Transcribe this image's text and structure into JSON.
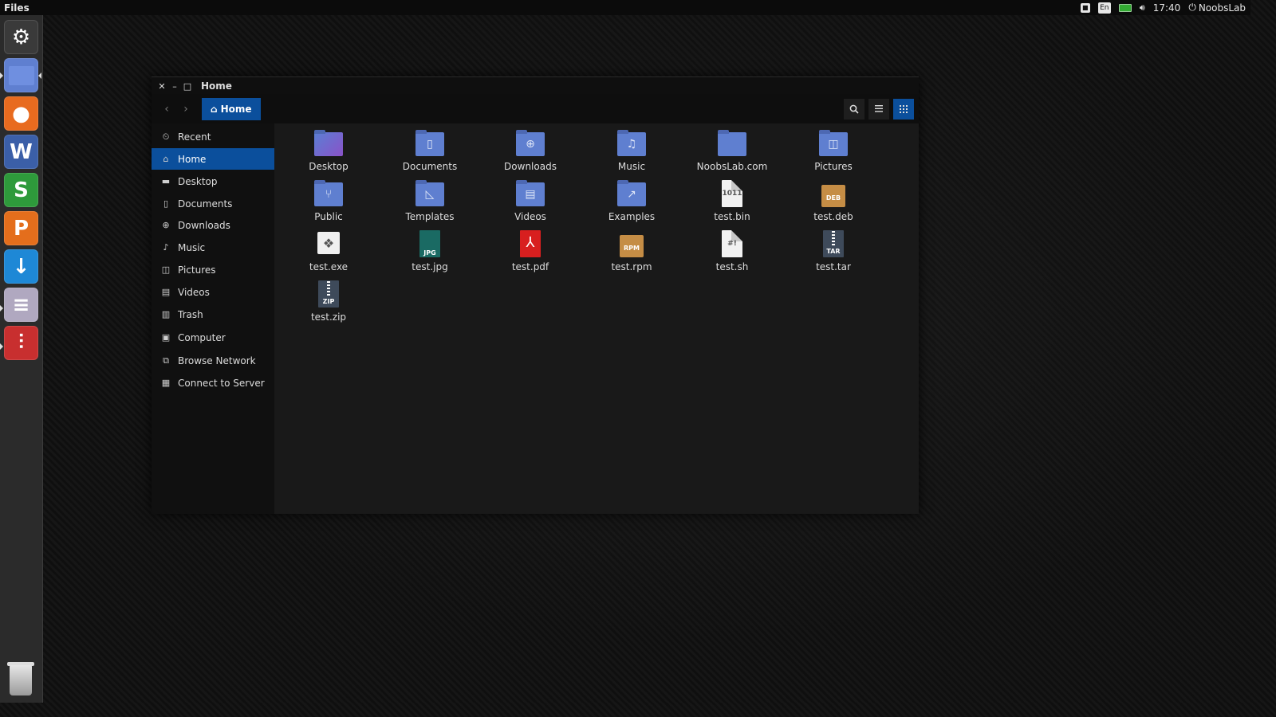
{
  "top_panel": {
    "app_name": "Files",
    "language": "En",
    "time": "17:40",
    "user": "NoobsLab"
  },
  "launcher": {
    "items": [
      {
        "name": "dash",
        "glyph": "⚙",
        "color": "#3a3a3a"
      },
      {
        "name": "files",
        "glyph": "",
        "color": "#5f7fd0"
      },
      {
        "name": "firefox",
        "glyph": "●",
        "color": "#e86b1f"
      },
      {
        "name": "writer",
        "glyph": "W",
        "color": "#3b5fa8"
      },
      {
        "name": "spreadsheet",
        "glyph": "S",
        "color": "#2e9a3b"
      },
      {
        "name": "presentation",
        "glyph": "P",
        "color": "#e46e1c"
      },
      {
        "name": "downloader",
        "glyph": "↓",
        "color": "#1e88d6"
      },
      {
        "name": "settings",
        "glyph": "≡",
        "color": "#b0a8c0"
      },
      {
        "name": "mixer",
        "glyph": "⫶",
        "color": "#c82f2f"
      }
    ]
  },
  "window": {
    "title": "Home",
    "path_label": "Home",
    "accent": "#0b4f9c"
  },
  "sidebar": {
    "items": [
      {
        "label": "Recent",
        "icon": "⏲",
        "selected": false
      },
      {
        "label": "Home",
        "icon": "⌂",
        "selected": true
      },
      {
        "label": "Desktop",
        "icon": "▬",
        "selected": false
      },
      {
        "label": "Documents",
        "icon": "▯",
        "selected": false
      },
      {
        "label": "Downloads",
        "icon": "⊕",
        "selected": false
      },
      {
        "label": "Music",
        "icon": "♪",
        "selected": false
      },
      {
        "label": "Pictures",
        "icon": "◫",
        "selected": false
      },
      {
        "label": "Videos",
        "icon": "▤",
        "selected": false
      },
      {
        "label": "Trash",
        "icon": "▥",
        "selected": false
      },
      {
        "label": "Computer",
        "icon": "▣",
        "selected": false
      },
      {
        "label": "Browse Network",
        "icon": "⧉",
        "selected": false
      },
      {
        "label": "Connect to Server",
        "icon": "▦",
        "selected": false
      }
    ]
  },
  "files": [
    {
      "label": "Desktop",
      "type": "folder-desktop",
      "glyph": ""
    },
    {
      "label": "Documents",
      "type": "folder",
      "glyph": "▯"
    },
    {
      "label": "Downloads",
      "type": "folder",
      "glyph": "⊕"
    },
    {
      "label": "Music",
      "type": "folder",
      "glyph": "♫"
    },
    {
      "label": "NoobsLab.com",
      "type": "folder",
      "glyph": ""
    },
    {
      "label": "Pictures",
      "type": "folder",
      "glyph": "◫"
    },
    {
      "label": "Public",
      "type": "folder",
      "glyph": "⑂"
    },
    {
      "label": "Templates",
      "type": "folder",
      "glyph": "◺"
    },
    {
      "label": "Videos",
      "type": "folder",
      "glyph": "▤"
    },
    {
      "label": "Examples",
      "type": "folder",
      "glyph": "↗"
    },
    {
      "label": "test.bin",
      "type": "doc",
      "glyph": "1011"
    },
    {
      "label": "test.deb",
      "type": "box",
      "glyph": "DEB"
    },
    {
      "label": "test.exe",
      "type": "exe",
      "glyph": "❖"
    },
    {
      "label": "test.jpg",
      "type": "jpg",
      "glyph": "JPG"
    },
    {
      "label": "test.pdf",
      "type": "pdf",
      "glyph": "⅄"
    },
    {
      "label": "test.rpm",
      "type": "box",
      "glyph": "RPM"
    },
    {
      "label": "test.sh",
      "type": "doc",
      "glyph": "#!"
    },
    {
      "label": "test.tar",
      "type": "arch",
      "glyph": "TAR"
    },
    {
      "label": "test.zip",
      "type": "arch",
      "glyph": "ZIP"
    }
  ]
}
